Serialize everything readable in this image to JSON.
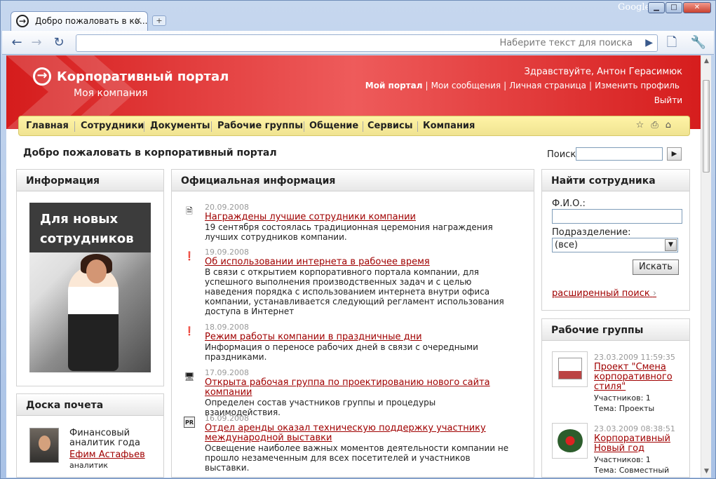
{
  "browser": {
    "tab_title": "Добро пожаловать в ко...",
    "tab_close": "×",
    "new_tab": "+",
    "brand": "Google",
    "search_placeholder": "Наберите текст для поиска",
    "controls": {
      "minimize": "▁",
      "maximize": "□",
      "close": "✕"
    }
  },
  "header": {
    "portal": "Корпоративный портал",
    "company": "Моя компания",
    "greeting": "Здравствуйте, Антон Герасимюк",
    "links": [
      "Мой портал",
      "Мои сообщения",
      "Личная страница",
      "Изменить профиль"
    ],
    "separator": "|",
    "logout": "Выйти"
  },
  "menu": {
    "items": [
      "Главная",
      "Сотрудники",
      "Документы",
      "Рабочие группы",
      "Общение",
      "Сервисы",
      "Компания"
    ],
    "icons": [
      "star-icon",
      "print-icon",
      "sitemap-icon"
    ]
  },
  "welcome": "Добро пожаловать в корпоративный портал",
  "search": {
    "label": "Поиск",
    "button": "▶"
  },
  "info_panel": {
    "title": "Информация",
    "banner": "Для новых\nсотрудников"
  },
  "official_panel": {
    "title": "Официальная информация",
    "items": [
      {
        "icon": "document-icon",
        "date": "20.09.2008",
        "title": "Награждены лучшие сотрудники компании",
        "text": "19 сентября состоялась традиционная церемония награждения\nлучших сотрудников компании."
      },
      {
        "icon": "alert-icon",
        "date": "19.09.2008",
        "title": "Об использовании интернета в рабочее время",
        "text": "В связи с открытием корпоративного портала компании, для\nуспешного выполнения производственных задач и с целью\nнаведения порядка с использованием интернета внутри офиса\nкомпании, устанавливается следующий регламент использования\nдоступа в Интернет"
      },
      {
        "icon": "alert-icon",
        "date": "18.09.2008",
        "title": "Режим работы компании в праздничные дни",
        "text": "Информация о переносе рабочих дней в связи с очередными\nпраздниками."
      },
      {
        "icon": "computer-icon",
        "date": "17.09.2008",
        "title": "Открыта рабочая группа по проектированию нового сайта\nкомпании",
        "text": "Определен состав участников группы и процедуры взаимодействия."
      },
      {
        "icon": "pr-icon",
        "date": "16.09.2008",
        "title": "Отдел аренды оказал техническую поддержку участнику\nмеждународной выставки",
        "text": "Освещение наиболее важных моментов деятельности компании не\nпрошло незамеченным для всех посетителей и участников\nвыставки."
      }
    ]
  },
  "honor_panel": {
    "title": "Доска почета",
    "role": "Финансовый\nаналитик года",
    "name": "Ефим Астафьев",
    "position": "аналитик"
  },
  "find_panel": {
    "title": "Найти сотрудника",
    "name_label": "Ф.И.О.:",
    "department_label": "Подразделение:",
    "department_value": "(все)",
    "button": "Искать",
    "advanced": "расширенный поиск",
    "advanced_arrow": "›"
  },
  "groups_panel": {
    "title": "Рабочие группы",
    "items": [
      {
        "date": "23.03.2009 11:59:35",
        "title": "Проект \"Смена\nкорпоративного\nстиля\"",
        "participants": "Участников: 1",
        "topic": "Тема: Проекты"
      },
      {
        "date": "23.03.2009 08:38:51",
        "title": "Корпоративный\nНовый год",
        "participants": "Участников: 1",
        "topic": "Тема: Совместный"
      }
    ]
  }
}
